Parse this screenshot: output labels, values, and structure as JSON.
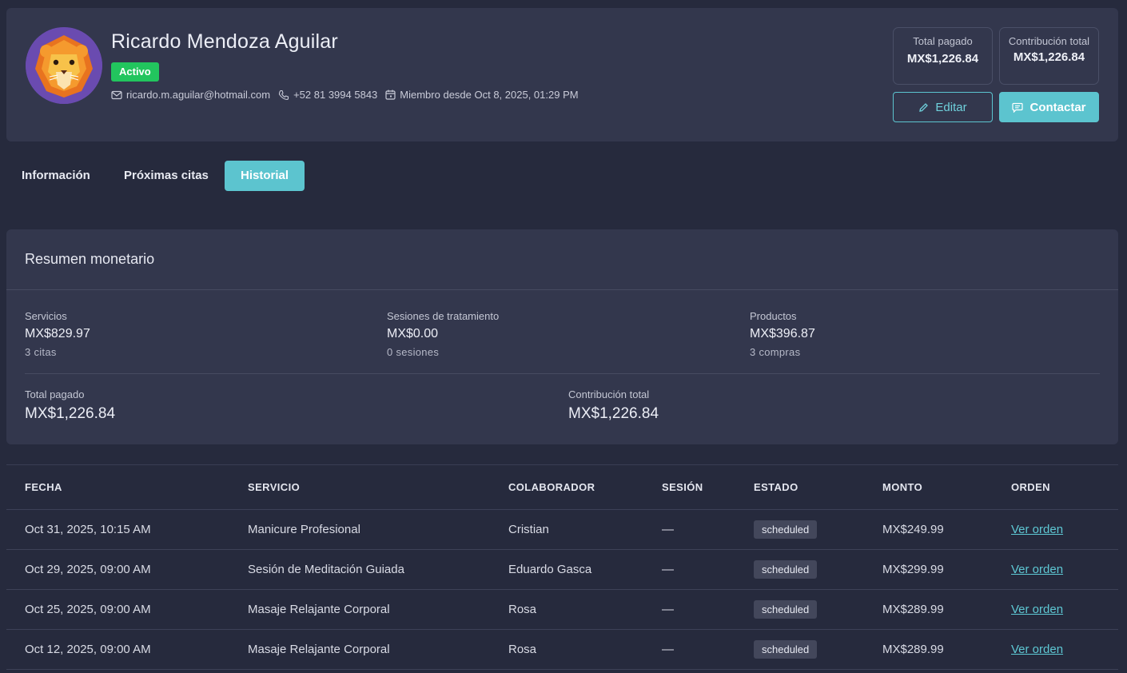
{
  "profile": {
    "name": "Ricardo Mendoza Aguilar",
    "status": "Activo",
    "email": "ricardo.m.aguilar@hotmail.com",
    "phone": "+52 81 3994 5843",
    "member_since": "Miembro desde Oct 8, 2025, 01:29 PM",
    "avatar_icon": "lion-avatar-icon"
  },
  "stats": {
    "paid_label": "Total pagado",
    "paid_value": "MX$1,226.84",
    "contrib_label": "Contribución total",
    "contrib_value": "MX$1,226.84"
  },
  "actions": {
    "edit_label": "Editar",
    "contact_label": "Contactar"
  },
  "tabs": [
    {
      "label": "Información"
    },
    {
      "label": "Próximas citas"
    },
    {
      "label": "Historial",
      "active": true
    }
  ],
  "summary": {
    "title": "Resumen monetario",
    "services": {
      "label": "Servicios",
      "value": "MX$829.97",
      "sub": "3 citas"
    },
    "sessions": {
      "label": "Sesiones de tratamiento",
      "value": "MX$0.00",
      "sub": "0 sesiones"
    },
    "products": {
      "label": "Productos",
      "value": "MX$396.87",
      "sub": "3 compras"
    },
    "total_paid": {
      "label": "Total pagado",
      "value": "MX$1,226.84"
    },
    "total_contrib": {
      "label": "Contribución total",
      "value": "MX$1,226.84"
    }
  },
  "table": {
    "headers": [
      "FECHA",
      "SERVICIO",
      "COLABORADOR",
      "SESIÓN",
      "ESTADO",
      "MONTO",
      "ORDEN"
    ],
    "rows": [
      {
        "date": "Oct 31, 2025, 10:15 AM",
        "service": "Manicure Profesional",
        "collaborator": "Cristian",
        "session": "—",
        "status": "scheduled",
        "amount": "MX$249.99",
        "order": "Ver orden"
      },
      {
        "date": "Oct 29, 2025, 09:00 AM",
        "service": "Sesión de Meditación Guiada",
        "collaborator": "Eduardo Gasca",
        "session": "—",
        "status": "scheduled",
        "amount": "MX$299.99",
        "order": "Ver orden"
      },
      {
        "date": "Oct 25, 2025, 09:00 AM",
        "service": "Masaje Relajante Corporal",
        "collaborator": "Rosa",
        "session": "—",
        "status": "scheduled",
        "amount": "MX$289.99",
        "order": "Ver orden"
      },
      {
        "date": "Oct 12, 2025, 09:00 AM",
        "service": "Masaje Relajante Corporal",
        "collaborator": "Rosa",
        "session": "—",
        "status": "scheduled",
        "amount": "MX$289.99",
        "order": "Ver orden"
      }
    ]
  },
  "colors": {
    "accent": "#5cc4cf",
    "active_badge": "#22c55e",
    "card_bg": "#33374d",
    "page_bg": "#262a3d"
  }
}
